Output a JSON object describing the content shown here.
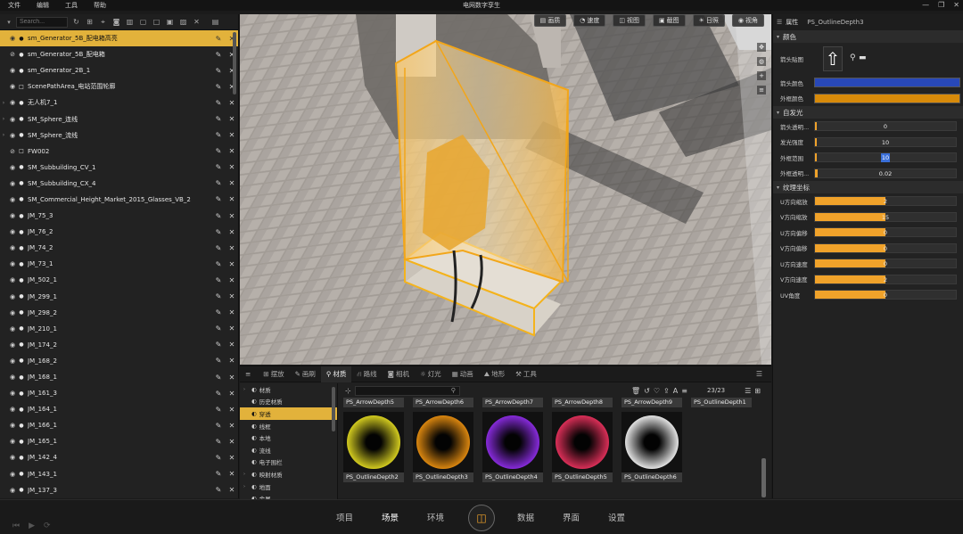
{
  "menubar": {
    "items": [
      "文件",
      "编辑",
      "工具",
      "帮助"
    ],
    "title": "电网数字孪生",
    "window_controls": [
      "—",
      "❐",
      "✕"
    ]
  },
  "outliner": {
    "search_placeholder": "Search...",
    "items": [
      {
        "label": "sm_Generator_5B_配电箱高亮",
        "selected": true,
        "expandable": false,
        "icon": "sphere"
      },
      {
        "label": "sm_Generator_5B_配电箱",
        "selected": false,
        "expandable": false,
        "icon": "sphere",
        "hidden": true
      },
      {
        "label": "sm_Generator_2B_1",
        "selected": false,
        "expandable": false,
        "icon": "sphere"
      },
      {
        "label": "ScenePathArea_电站范围轮廓",
        "selected": false,
        "expandable": false,
        "icon": "square"
      },
      {
        "label": "无人机7_1",
        "selected": false,
        "expandable": true,
        "icon": "sphere"
      },
      {
        "label": "SM_Sphere_连线",
        "selected": false,
        "expandable": true,
        "icon": "sphere"
      },
      {
        "label": "SM_Sphere_流线",
        "selected": false,
        "expandable": true,
        "icon": "sphere"
      },
      {
        "label": "FW002",
        "selected": false,
        "expandable": false,
        "icon": "square",
        "hidden": true
      },
      {
        "label": "SM_Subbuilding_CV_1",
        "selected": false,
        "expandable": false,
        "icon": "sphere"
      },
      {
        "label": "SM_Subbuilding_CX_4",
        "selected": false,
        "expandable": false,
        "icon": "sphere"
      },
      {
        "label": "SM_Commercial_Height_Market_2015_Glasses_VB_2",
        "selected": false,
        "expandable": false,
        "icon": "sphere"
      },
      {
        "label": "JM_75_3",
        "selected": false,
        "expandable": false,
        "icon": "sphere"
      },
      {
        "label": "JM_76_2",
        "selected": false,
        "expandable": false,
        "icon": "sphere"
      },
      {
        "label": "JM_74_2",
        "selected": false,
        "expandable": false,
        "icon": "sphere"
      },
      {
        "label": "JM_73_1",
        "selected": false,
        "expandable": false,
        "icon": "sphere"
      },
      {
        "label": "JM_502_1",
        "selected": false,
        "expandable": false,
        "icon": "sphere"
      },
      {
        "label": "JM_299_1",
        "selected": false,
        "expandable": false,
        "icon": "sphere"
      },
      {
        "label": "JM_298_2",
        "selected": false,
        "expandable": false,
        "icon": "sphere"
      },
      {
        "label": "JM_210_1",
        "selected": false,
        "expandable": false,
        "icon": "sphere"
      },
      {
        "label": "JM_174_2",
        "selected": false,
        "expandable": false,
        "icon": "sphere"
      },
      {
        "label": "JM_168_2",
        "selected": false,
        "expandable": false,
        "icon": "sphere"
      },
      {
        "label": "JM_168_1",
        "selected": false,
        "expandable": false,
        "icon": "sphere"
      },
      {
        "label": "JM_161_3",
        "selected": false,
        "expandable": false,
        "icon": "sphere"
      },
      {
        "label": "JM_164_1",
        "selected": false,
        "expandable": false,
        "icon": "sphere"
      },
      {
        "label": "JM_166_1",
        "selected": false,
        "expandable": false,
        "icon": "sphere"
      },
      {
        "label": "JM_165_1",
        "selected": false,
        "expandable": false,
        "icon": "sphere"
      },
      {
        "label": "JM_142_4",
        "selected": false,
        "expandable": false,
        "icon": "sphere"
      },
      {
        "label": "JM_143_1",
        "selected": false,
        "expandable": false,
        "icon": "sphere"
      },
      {
        "label": "JM_137_3",
        "selected": false,
        "expandable": false,
        "icon": "sphere"
      }
    ]
  },
  "viewport": {
    "buttons": [
      {
        "icon": "▤",
        "label": "画质"
      },
      {
        "icon": "◔",
        "label": "速度"
      },
      {
        "icon": "◫",
        "label": "视图"
      },
      {
        "icon": "▣",
        "label": "截图"
      },
      {
        "icon": "☀",
        "label": "日照"
      },
      {
        "icon": "◉",
        "label": "视角"
      }
    ]
  },
  "properties": {
    "title": "属性",
    "object_name": "PS_OutlineDepth3",
    "sections": {
      "color": {
        "title": "颜色",
        "arrow_texture_label": "箭头贴图",
        "arrow_color_label": "箭头颜色",
        "arrow_color": "#2848b8",
        "outline_color_label": "外框颜色",
        "outline_color": "#d78a0a"
      },
      "emissive": {
        "title": "自发光",
        "rows": [
          {
            "label": "箭头透明...",
            "value": "0",
            "fill": 0,
            "highlight": false
          },
          {
            "label": "发光强度",
            "value": "10",
            "fill": 0.01,
            "highlight": false
          },
          {
            "label": "外框范围",
            "value": "10",
            "fill": 0,
            "highlight": true
          },
          {
            "label": "外框透明...",
            "value": "0.02",
            "fill": 0.02,
            "highlight": false
          }
        ]
      },
      "texture": {
        "title": "纹理坐标",
        "rows": [
          {
            "label": "U方向缩放",
            "value": "2",
            "fill": 0.5
          },
          {
            "label": "V方向缩放",
            "value": "15",
            "fill": 0.5
          },
          {
            "label": "U方向偏移",
            "value": "0",
            "fill": 0.5
          },
          {
            "label": "V方向偏移",
            "value": "0",
            "fill": 0.5
          },
          {
            "label": "U方向速度",
            "value": "0",
            "fill": 0.5
          },
          {
            "label": "V方向速度",
            "value": "2",
            "fill": 0.5
          },
          {
            "label": "UV角度",
            "value": "0",
            "fill": 0.5
          }
        ]
      }
    }
  },
  "asset_panel": {
    "tabs": [
      {
        "icon": "≡",
        "label": ""
      },
      {
        "icon": "⊞",
        "label": "摆放"
      },
      {
        "icon": "✎",
        "label": "画刷"
      },
      {
        "icon": "⚲",
        "label": "材质",
        "active": true
      },
      {
        "icon": "⛙",
        "label": "路线"
      },
      {
        "icon": "◙",
        "label": "相机"
      },
      {
        "icon": "☼",
        "label": "灯光"
      },
      {
        "icon": "▦",
        "label": "动画"
      },
      {
        "icon": "⛰",
        "label": "地形"
      },
      {
        "icon": "⚒",
        "label": "工具"
      }
    ],
    "categories": [
      {
        "label": "材质",
        "expandable": true,
        "active": false
      },
      {
        "label": "历史材质",
        "expandable": false,
        "active": false
      },
      {
        "label": "穿透",
        "expandable": false,
        "active": true
      },
      {
        "label": "线框",
        "expandable": false,
        "active": false
      },
      {
        "label": "本地",
        "expandable": false,
        "active": false
      },
      {
        "label": "流线",
        "expandable": false,
        "active": false
      },
      {
        "label": "电子围栏",
        "expandable": false,
        "active": false
      },
      {
        "label": "映射材质",
        "expandable": true,
        "active": false
      },
      {
        "label": "地面",
        "expandable": true,
        "active": false
      },
      {
        "label": "金属",
        "expandable": false,
        "active": false
      }
    ],
    "count": "23/23",
    "thumbnails_row1": [
      {
        "label": "PS_ArrowDepth5"
      },
      {
        "label": "PS_ArrowDepth6"
      },
      {
        "label": "PS_ArrowDepth7"
      },
      {
        "label": "PS_ArrowDepth8"
      },
      {
        "label": "PS_ArrowDepth9"
      },
      {
        "label": "PS_OutlineDepth1"
      }
    ],
    "thumbnails_row2": [
      {
        "label": "PS_OutlineDepth2",
        "color": "#d8d020"
      },
      {
        "label": "PS_OutlineDepth3",
        "color": "#e08a10"
      },
      {
        "label": "PS_OutlineDepth4",
        "color": "#8a2ce0"
      },
      {
        "label": "PS_OutlineDepth5",
        "color": "#e0305a"
      },
      {
        "label": "PS_OutlineDepth6",
        "color": "#e8e8e8"
      }
    ]
  },
  "bottom_nav": {
    "items": [
      {
        "label": "项目",
        "active": false
      },
      {
        "label": "场景",
        "active": true
      },
      {
        "label": "环境",
        "active": false
      },
      {
        "label": "数据",
        "active": false
      },
      {
        "label": "界面",
        "active": false
      },
      {
        "label": "设置",
        "active": false
      }
    ]
  }
}
